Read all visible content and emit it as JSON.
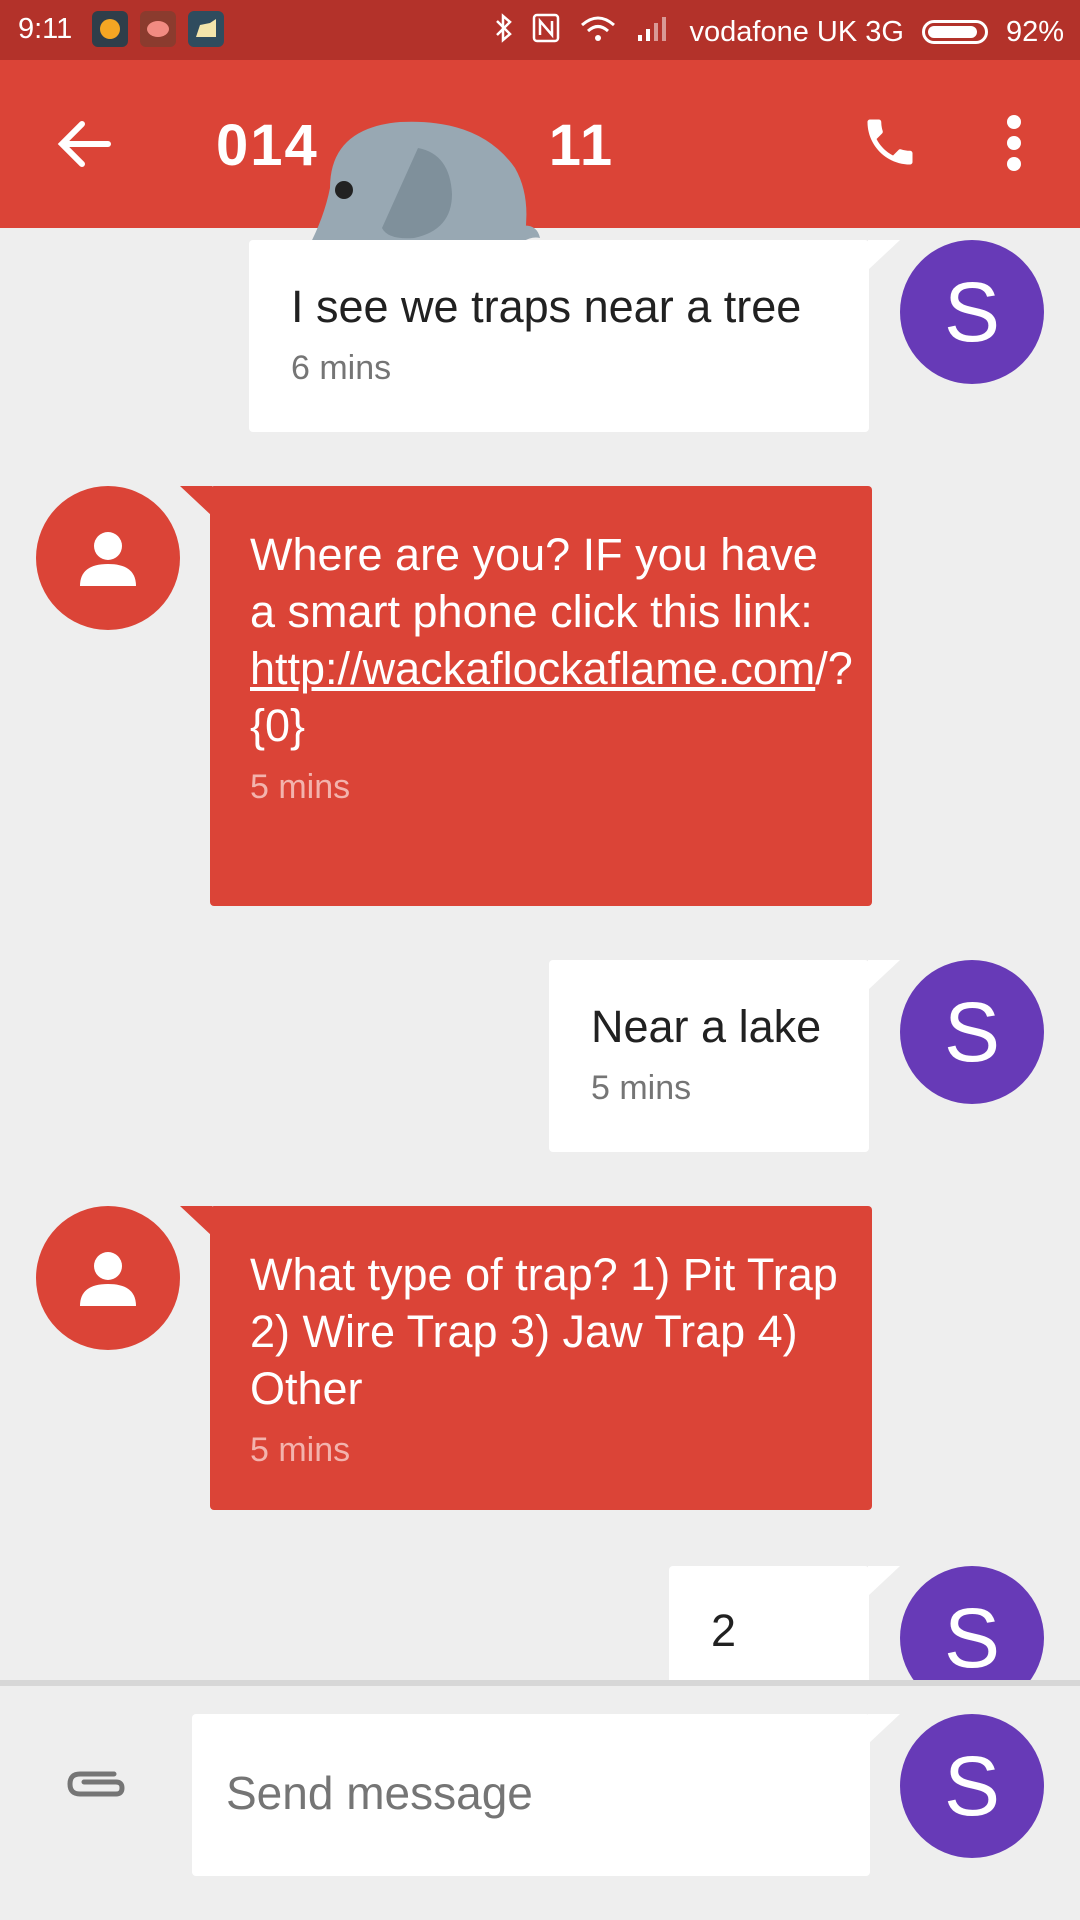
{
  "status_bar": {
    "time": "9:11",
    "carrier": "vodafone UK 3G",
    "battery": "92%",
    "icons": [
      "app-icon-1",
      "app-icon-2",
      "app-icon-3",
      "bluetooth-icon",
      "nfc-icon",
      "wifi-icon",
      "signal-icon",
      "battery-icon"
    ]
  },
  "app_bar": {
    "title": "014",
    "title_suffix": "11",
    "icons": [
      "back-arrow-icon",
      "phone-icon",
      "more-vert-icon"
    ]
  },
  "conversation": {
    "messages": [
      {
        "direction": "incoming",
        "avatar_letter": "S",
        "text": "I see we traps near a tree",
        "time": "6 mins"
      },
      {
        "direction": "outgoing",
        "text_before": "Where are you? IF you have a smart phone click this link: ",
        "link": "http://wackaflockaflame.com",
        "text_after": "/?{0}",
        "time": "5 mins"
      },
      {
        "direction": "incoming",
        "avatar_letter": "S",
        "text": "Near a lake",
        "time": "5 mins"
      },
      {
        "direction": "outgoing",
        "text": "What type of trap?  1) Pit Trap  2) Wire Trap  3) Jaw Trap  4) Other",
        "time": "5 mins"
      },
      {
        "direction": "incoming",
        "avatar_letter": "S",
        "text": "2",
        "time": ""
      }
    ]
  },
  "composer": {
    "placeholder": "Send message",
    "avatar_letter": "S"
  },
  "colors": {
    "primary": "#db4437",
    "status_bar": "#b3322a",
    "avatar": "#673ab7",
    "background": "#eeeeee"
  }
}
